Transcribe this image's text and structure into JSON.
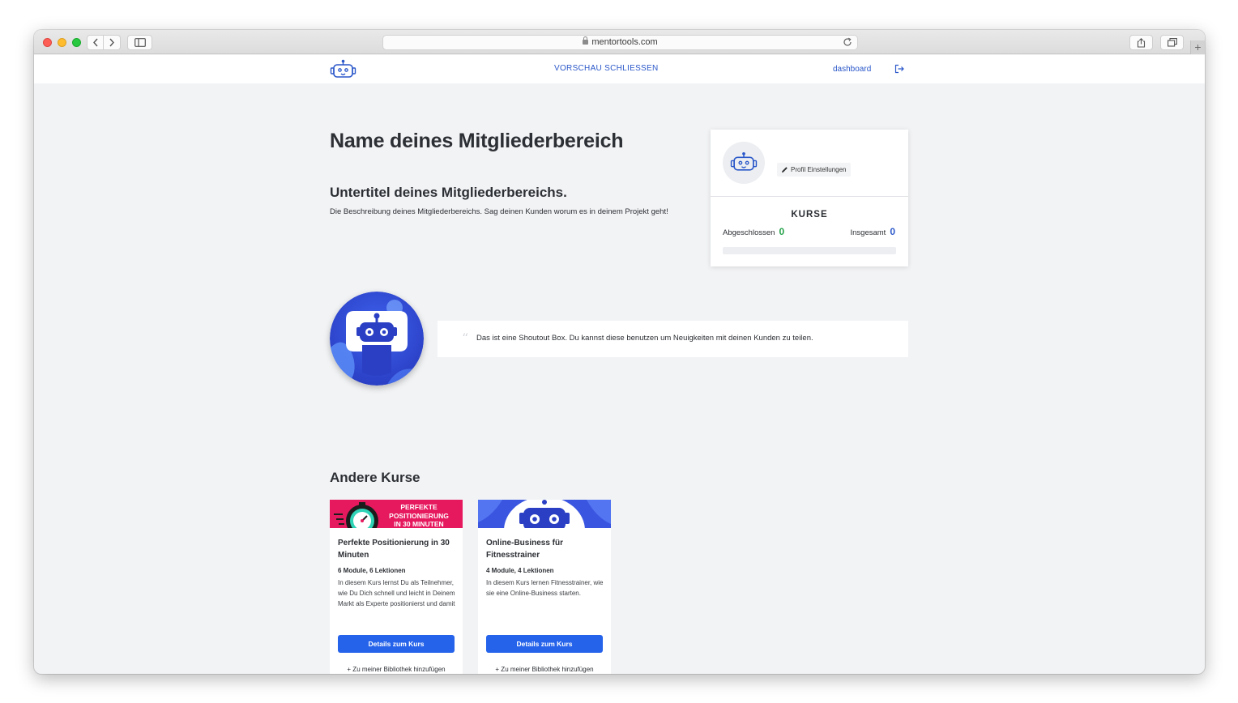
{
  "browser": {
    "url": "mentortools.com"
  },
  "header": {
    "preview_close": "VORSCHAU SCHLIESSEN",
    "dashboard": "dashboard"
  },
  "hero": {
    "title": "Name deines Mitgliederbereich",
    "subtitle": "Untertitel deines Mitgliederbereichs.",
    "description": "Die Beschreibung deines Mitgliederbereichs. Sag deinen Kunden worum es in deinem Projekt geht!"
  },
  "profile": {
    "settings_label": "Profil Einstellungen",
    "courses_heading": "KURSE",
    "completed_label": "Abgeschlossen",
    "completed_value": "0",
    "total_label": "Insgesamt",
    "total_value": "0",
    "progress_fraction": 0
  },
  "shoutout": {
    "text": "Das ist eine Shoutout Box. Du kannst diese benutzen um Neuigkeiten mit deinen Kunden zu teilen."
  },
  "other_courses": {
    "heading": "Andere Kurse",
    "courses": [
      {
        "banner_line1": "PERFEKTE",
        "banner_line2": "POSITIONIERUNG",
        "banner_line3": "IN 30 MINUTEN",
        "title": "Perfekte Positionierung in 30 Minuten",
        "meta": "6 Module, 6 Lektionen",
        "description": "In diesem Kurs lernst Du als Teilnehmer, wie Du Dich schnell und leicht in Deinem Markt als Experte positionierst und damit",
        "button": "Details zum Kurs",
        "library": "+ Zu meiner Bibliothek hinzufügen"
      },
      {
        "title": "Online-Business für Fitnesstrainer",
        "meta": "4 Module, 4 Lektionen",
        "description": "In diesem Kurs lernen Fitnesstrainer, wie sie eine Online-Business starten.",
        "button": "Details zum Kurs",
        "library": "+ Zu meiner Bibliothek hinzufügen"
      }
    ]
  },
  "colors": {
    "accent": "#2a57c9",
    "button": "#2563eb",
    "banner_pink": "#e6195f",
    "stat_green": "#24a148",
    "background": "#f2f3f5"
  },
  "icons": [
    "back-icon",
    "forward-icon",
    "sidebar-icon",
    "lock-icon",
    "reload-icon",
    "share-icon",
    "tabs-icon",
    "robot-logo-icon",
    "logout-icon",
    "pencil-icon",
    "quote-icon"
  ]
}
